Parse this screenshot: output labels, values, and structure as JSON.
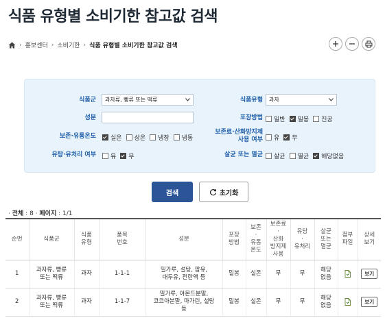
{
  "page": {
    "title": "식품 유형별 소비기한 참고값 검색"
  },
  "breadcrumb": [
    "홍보센터",
    "소비기한",
    "식품 유형별 소비기한 참고값 검색"
  ],
  "form": {
    "food_group_label": "식품군",
    "food_group_value": "과자류, 빵류 또는 떡류",
    "food_type_label": "식품유형",
    "food_type_value": "과자",
    "ingredient_label": "성분",
    "ingredient_value": "",
    "packaging_label": "포장방법",
    "packaging_options": [
      {
        "label": "일반",
        "checked": false
      },
      {
        "label": "밀봉",
        "checked": true
      },
      {
        "label": "진공",
        "checked": false
      }
    ],
    "storage_label": "보존·유통온도",
    "storage_options": [
      {
        "label": "실온",
        "checked": true
      },
      {
        "label": "상온",
        "checked": false
      },
      {
        "label": "냉장",
        "checked": false
      },
      {
        "label": "냉동",
        "checked": false
      }
    ],
    "preservative_label_line1": "보존료·산화방지제",
    "preservative_label_line2": "사용 여부",
    "preservative_options": [
      {
        "label": "유",
        "checked": false
      },
      {
        "label": "무",
        "checked": true
      }
    ],
    "sugar_label": "유탕·유처리 여부",
    "sugar_options": [
      {
        "label": "유",
        "checked": false
      },
      {
        "label": "무",
        "checked": true
      }
    ],
    "sterilize_label": "살균 또는 멸균",
    "sterilize_options": [
      {
        "label": "살균",
        "checked": false
      },
      {
        "label": "멸균",
        "checked": false
      },
      {
        "label": "해당없음",
        "checked": true
      }
    ],
    "search_button": "검색",
    "reset_button": "초기화"
  },
  "summary": {
    "total_label": "전체",
    "total_value": "8",
    "page_label": "페이지",
    "page_value": "1/1"
  },
  "table": {
    "headers": [
      "순번",
      "식품군",
      "식품\n유형",
      "품목\n번호",
      "성분",
      "포장\n방법",
      "보존\n·\n유통\n온도",
      "보존료\n·\n산화\n방지제\n사용",
      "유탕\n·\n유처리",
      "살균\n또는\n멸균",
      "첨부\n파일",
      "상세\n보기"
    ],
    "rows": [
      {
        "no": "1",
        "group": "과자류, 빵류\n또는 떡류",
        "type": "과자",
        "item_no": "1-1-1",
        "ingredients": "밀가루, 설탕, 팜유,\n대두유, 전란액 등",
        "packaging": "밀봉",
        "storage": "실온",
        "preservative": "무",
        "oil": "무",
        "sterilize": "해당\n없음",
        "view": "보기"
      },
      {
        "no": "2",
        "group": "과자류, 빵류\n또는 떡류",
        "type": "과자",
        "item_no": "1-1-7",
        "ingredients": "밀가루, 아몬드분말,\n코코아분말, 마가린, 설탕\n등",
        "packaging": "밀봉",
        "storage": "실온",
        "preservative": "무",
        "oil": "무",
        "sterilize": "해당\n없음",
        "view": "보기"
      }
    ]
  }
}
